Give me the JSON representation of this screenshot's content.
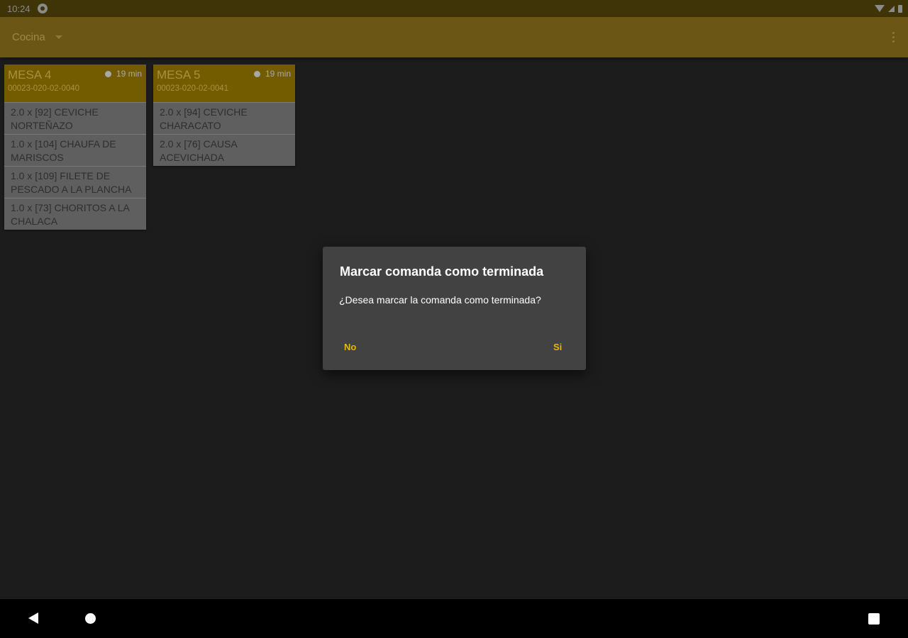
{
  "status_bar": {
    "time": "10:24",
    "icons": [
      "app-notification-icon",
      "wifi-icon",
      "signal-icon",
      "battery-icon"
    ]
  },
  "toolbar": {
    "spinner_value": "Cocina",
    "icons": [
      "caret-down-icon",
      "more-vert-icon"
    ]
  },
  "orders": [
    {
      "title": "MESA 4",
      "code": "00023-020-02-0040",
      "elapsed": "19 min",
      "items": [
        "2.0 x [92] CEVICHE NORTEÑAZO",
        "1.0 x [104] CHAUFA DE MARISCOS",
        "1.0 x [109] FILETE DE PESCADO A LA PLANCHA",
        "1.0 x [73] CHORITOS A LA CHALACA"
      ]
    },
    {
      "title": "MESA 5",
      "code": "00023-020-02-0041",
      "elapsed": "19 min",
      "items": [
        "2.0 x [94] CEVICHE CHARACATO",
        "2.0 x [76] CAUSA ACEVICHADA"
      ]
    }
  ],
  "dialog": {
    "title": "Marcar comanda como terminada",
    "message": "¿Desea marcar la comanda como terminada?",
    "negative_label": "No",
    "positive_label": "Si"
  },
  "colors": {
    "accent": "#e6b800",
    "toolbar": "#6b5616",
    "card_header": "#735b00",
    "background": "#1c1c1c",
    "dialog": "#424242"
  }
}
